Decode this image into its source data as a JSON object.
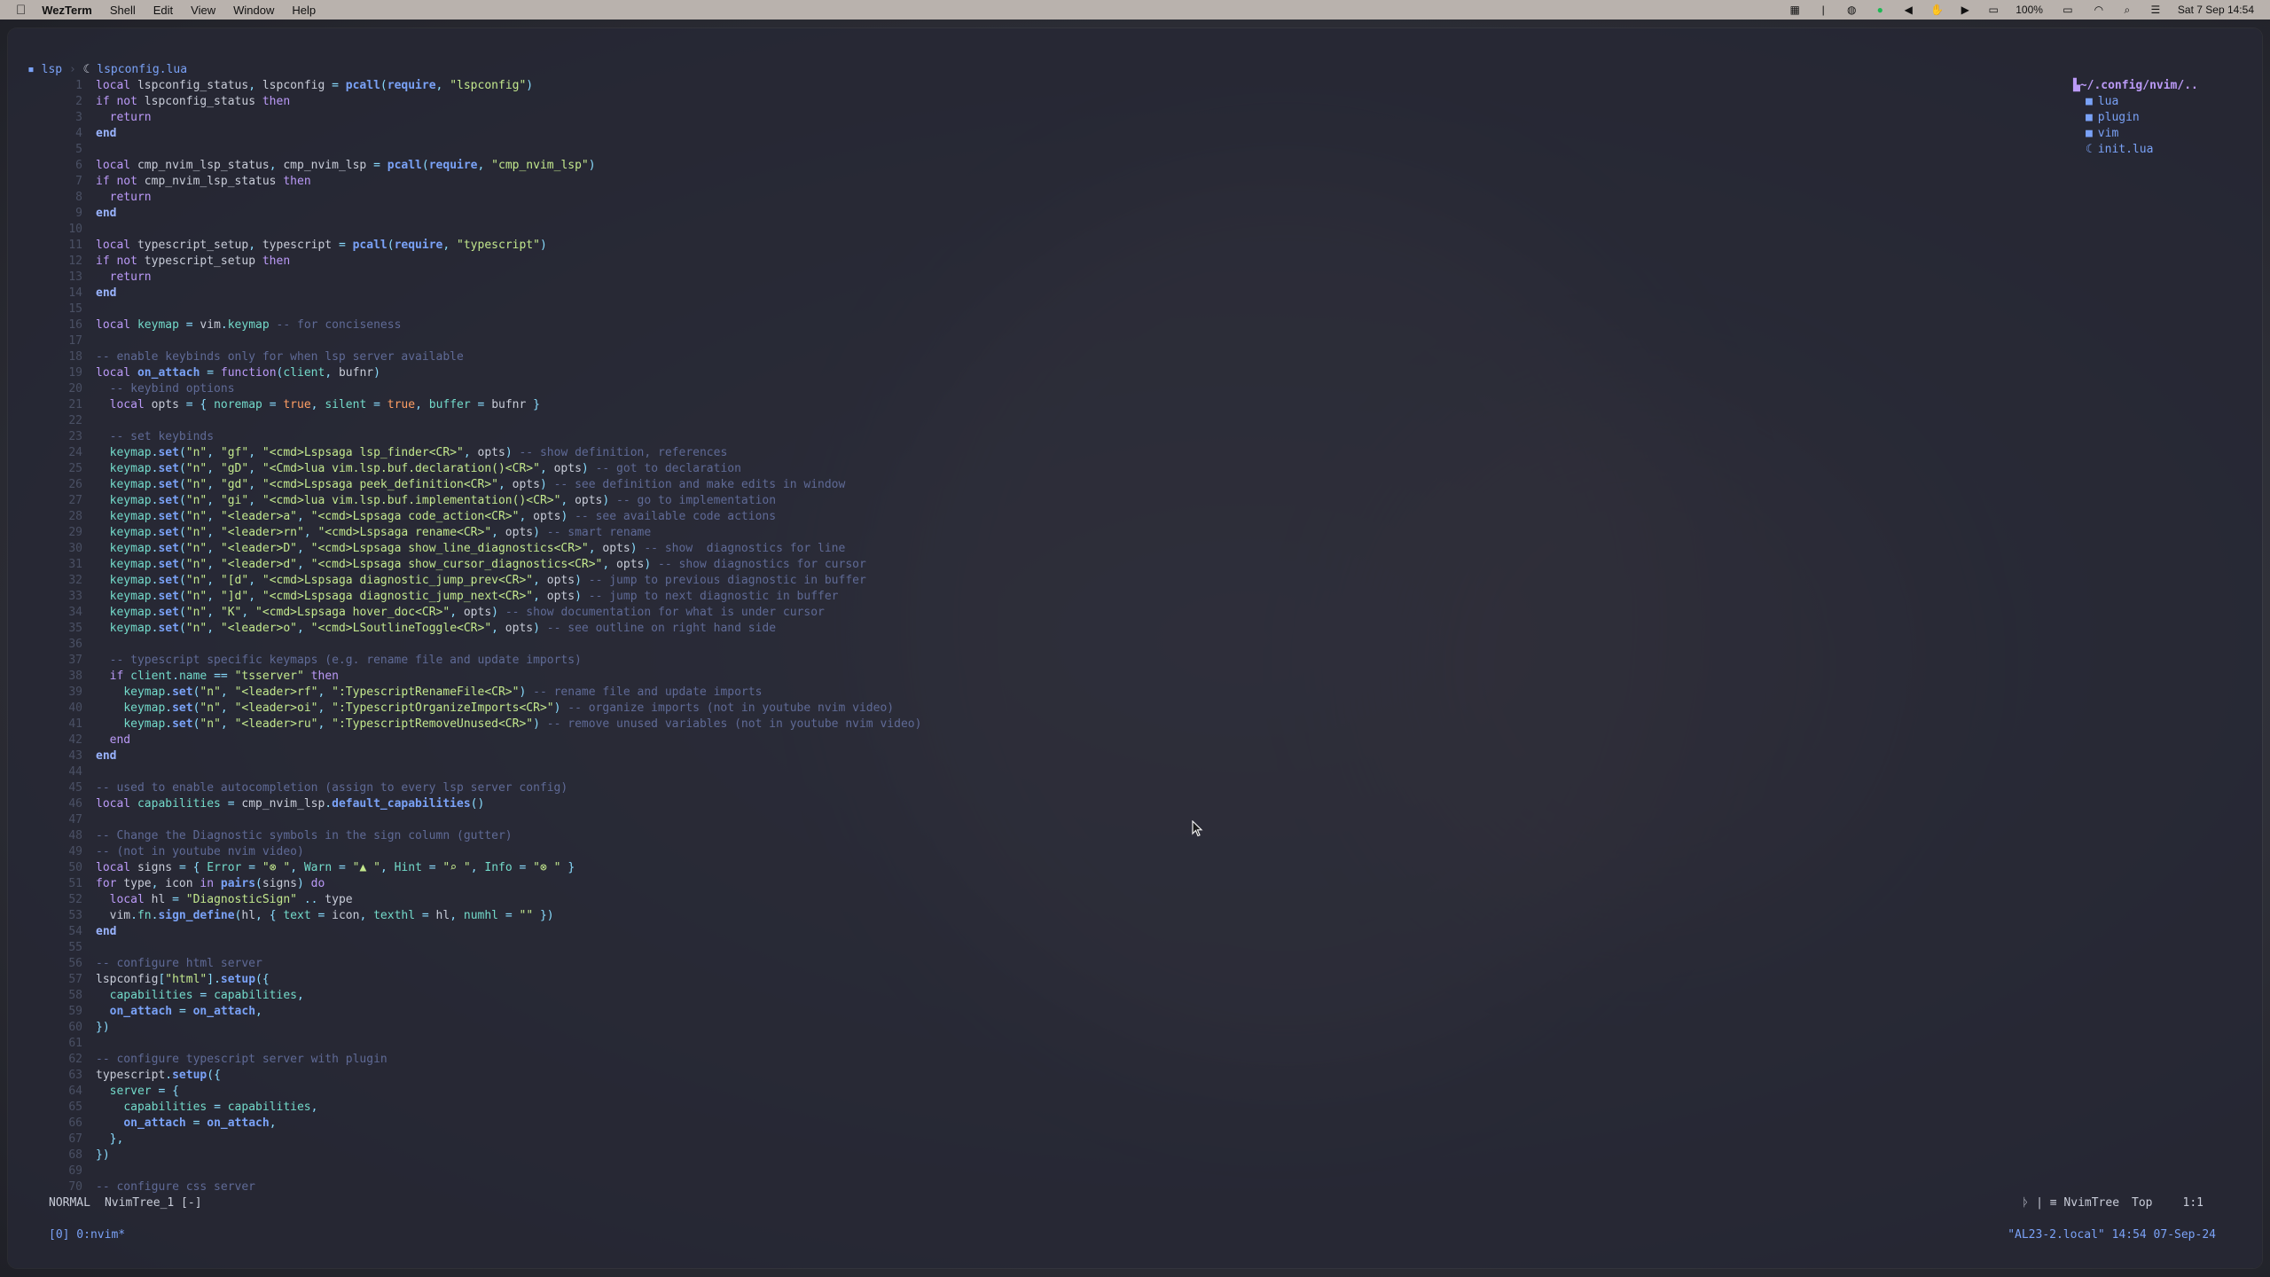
{
  "menubar": {
    "app_name": "WezTerm",
    "menus": [
      "Shell",
      "Edit",
      "View",
      "Window",
      "Help"
    ],
    "battery": "100%",
    "datetime": "Sat 7 Sep 14:54"
  },
  "breadcrumb": {
    "folder": "lsp",
    "separator": "›",
    "file": "lspconfig.lua"
  },
  "tree": {
    "root": "~/.config/nvim/..",
    "items": [
      {
        "name": "lua",
        "icon": "folder-icon"
      },
      {
        "name": "plugin",
        "icon": "folder-icon"
      },
      {
        "name": "vim",
        "icon": "folder-icon"
      },
      {
        "name": "init.lua",
        "icon": "lua-file-icon"
      }
    ]
  },
  "lines": [
    {
      "n": "1",
      "code": "local lspconfig_status, lspconfig = pcall(require, \"lspconfig\")"
    },
    {
      "n": "2",
      "code": "if not lspconfig_status then"
    },
    {
      "n": "3",
      "code": "  return"
    },
    {
      "n": "4",
      "code": "end"
    },
    {
      "n": "5",
      "code": ""
    },
    {
      "n": "6",
      "code": "local cmp_nvim_lsp_status, cmp_nvim_lsp = pcall(require, \"cmp_nvim_lsp\")"
    },
    {
      "n": "7",
      "code": "if not cmp_nvim_lsp_status then"
    },
    {
      "n": "8",
      "code": "  return"
    },
    {
      "n": "9",
      "code": "end"
    },
    {
      "n": "10",
      "code": ""
    },
    {
      "n": "11",
      "code": "local typescript_setup, typescript = pcall(require, \"typescript\")"
    },
    {
      "n": "12",
      "code": "if not typescript_setup then"
    },
    {
      "n": "13",
      "code": "  return"
    },
    {
      "n": "14",
      "code": "end"
    },
    {
      "n": "15",
      "code": ""
    },
    {
      "n": "16",
      "code": "local keymap = vim.keymap -- for conciseness"
    },
    {
      "n": "17",
      "code": ""
    },
    {
      "n": "18",
      "code": "-- enable keybinds only for when lsp server available"
    },
    {
      "n": "19",
      "code": "local on_attach = function(client, bufnr)"
    },
    {
      "n": "20",
      "code": "  -- keybind options"
    },
    {
      "n": "21",
      "code": "  local opts = { noremap = true, silent = true, buffer = bufnr }"
    },
    {
      "n": "22",
      "code": ""
    },
    {
      "n": "23",
      "code": "  -- set keybinds"
    },
    {
      "n": "24",
      "code": "  keymap.set(\"n\", \"gf\", \"<cmd>Lspsaga lsp_finder<CR>\", opts) -- show definition, references"
    },
    {
      "n": "25",
      "code": "  keymap.set(\"n\", \"gD\", \"<Cmd>lua vim.lsp.buf.declaration()<CR>\", opts) -- got to declaration"
    },
    {
      "n": "26",
      "code": "  keymap.set(\"n\", \"gd\", \"<cmd>Lspsaga peek_definition<CR>\", opts) -- see definition and make edits in window"
    },
    {
      "n": "27",
      "code": "  keymap.set(\"n\", \"gi\", \"<cmd>lua vim.lsp.buf.implementation()<CR>\", opts) -- go to implementation"
    },
    {
      "n": "28",
      "code": "  keymap.set(\"n\", \"<leader>a\", \"<cmd>Lspsaga code_action<CR>\", opts) -- see available code actions"
    },
    {
      "n": "29",
      "code": "  keymap.set(\"n\", \"<leader>rn\", \"<cmd>Lspsaga rename<CR>\", opts) -- smart rename"
    },
    {
      "n": "30",
      "code": "  keymap.set(\"n\", \"<leader>D\", \"<cmd>Lspsaga show_line_diagnostics<CR>\", opts) -- show  diagnostics for line"
    },
    {
      "n": "31",
      "code": "  keymap.set(\"n\", \"<leader>d\", \"<cmd>Lspsaga show_cursor_diagnostics<CR>\", opts) -- show diagnostics for cursor"
    },
    {
      "n": "32",
      "code": "  keymap.set(\"n\", \"[d\", \"<cmd>Lspsaga diagnostic_jump_prev<CR>\", opts) -- jump to previous diagnostic in buffer"
    },
    {
      "n": "33",
      "code": "  keymap.set(\"n\", \"]d\", \"<cmd>Lspsaga diagnostic_jump_next<CR>\", opts) -- jump to next diagnostic in buffer"
    },
    {
      "n": "34",
      "code": "  keymap.set(\"n\", \"K\", \"<cmd>Lspsaga hover_doc<CR>\", opts) -- show documentation for what is under cursor"
    },
    {
      "n": "35",
      "code": "  keymap.set(\"n\", \"<leader>o\", \"<cmd>LSoutlineToggle<CR>\", opts) -- see outline on right hand side"
    },
    {
      "n": "36",
      "code": ""
    },
    {
      "n": "37",
      "code": "  -- typescript specific keymaps (e.g. rename file and update imports)"
    },
    {
      "n": "38",
      "code": "  if client.name == \"tsserver\" then"
    },
    {
      "n": "39",
      "code": "    keymap.set(\"n\", \"<leader>rf\", \":TypescriptRenameFile<CR>\") -- rename file and update imports"
    },
    {
      "n": "40",
      "code": "    keymap.set(\"n\", \"<leader>oi\", \":TypescriptOrganizeImports<CR>\") -- organize imports (not in youtube nvim video)"
    },
    {
      "n": "41",
      "code": "    keymap.set(\"n\", \"<leader>ru\", \":TypescriptRemoveUnused<CR>\") -- remove unused variables (not in youtube nvim video)"
    },
    {
      "n": "42",
      "code": "  end"
    },
    {
      "n": "43",
      "code": "end"
    },
    {
      "n": "44",
      "code": ""
    },
    {
      "n": "45",
      "code": "-- used to enable autocompletion (assign to every lsp server config)"
    },
    {
      "n": "46",
      "code": "local capabilities = cmp_nvim_lsp.default_capabilities()"
    },
    {
      "n": "47",
      "code": ""
    },
    {
      "n": "48",
      "code": "-- Change the Diagnostic symbols in the sign column (gutter)"
    },
    {
      "n": "49",
      "code": "-- (not in youtube nvim video)"
    },
    {
      "n": "50",
      "code": "local signs = { Error = \"⊗ \", Warn = \"▲ \", Hint = \"⌕ \", Info = \"⊗ \" }"
    },
    {
      "n": "51",
      "code": "for type, icon in pairs(signs) do"
    },
    {
      "n": "52",
      "code": "  local hl = \"DiagnosticSign\" .. type"
    },
    {
      "n": "53",
      "code": "  vim.fn.sign_define(hl, { text = icon, texthl = hl, numhl = \"\" })"
    },
    {
      "n": "54",
      "code": "end"
    },
    {
      "n": "55",
      "code": ""
    },
    {
      "n": "56",
      "code": "-- configure html server"
    },
    {
      "n": "57",
      "code": "lspconfig[\"html\"].setup({"
    },
    {
      "n": "58",
      "code": "  capabilities = capabilities,"
    },
    {
      "n": "59",
      "code": "  on_attach = on_attach,"
    },
    {
      "n": "60",
      "code": "})"
    },
    {
      "n": "61",
      "code": ""
    },
    {
      "n": "62",
      "code": "-- configure typescript server with plugin"
    },
    {
      "n": "63",
      "code": "typescript.setup({"
    },
    {
      "n": "64",
      "code": "  server = {"
    },
    {
      "n": "65",
      "code": "    capabilities = capabilities,"
    },
    {
      "n": "66",
      "code": "    on_attach = on_attach,"
    },
    {
      "n": "67",
      "code": "  },"
    },
    {
      "n": "68",
      "code": "})"
    },
    {
      "n": "69",
      "code": ""
    },
    {
      "n": "70",
      "code": "-- configure css server"
    }
  ],
  "statusline": {
    "mode": "NORMAL",
    "buffer": "NvimTree_1 [-]",
    "branch_info": "ᚦ | ≡ NvimTree",
    "position_label": "Top",
    "cursor": "1:1"
  },
  "tmux": {
    "window": "[0] 0:nvim*",
    "host_time": "\"AL23-2.local\" 14:54 07-Sep-24"
  },
  "colors": {
    "accent": "#7aa2f7",
    "keyword": "#bb9af7",
    "string": "#c3e88d",
    "comment": "#5f6a96",
    "field": "#73daca",
    "boolean": "#ff9e64"
  }
}
